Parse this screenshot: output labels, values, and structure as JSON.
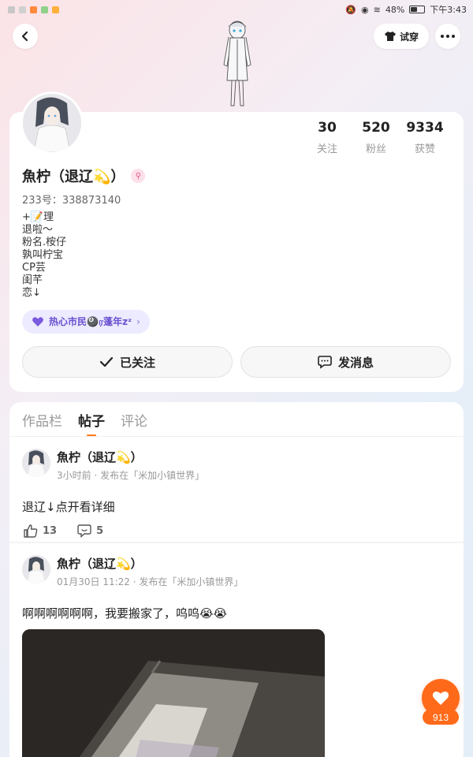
{
  "status_bar": {
    "battery": "48%",
    "battery_level": 0.48,
    "time": "下午3:43"
  },
  "header": {
    "try_on_label": "试穿"
  },
  "profile": {
    "stats": [
      {
        "value": "30",
        "label": "关注"
      },
      {
        "value": "520",
        "label": "粉丝"
      },
      {
        "value": "9334",
        "label": "获赞"
      }
    ],
    "name": "魚柠（退辽💫）",
    "uid": "233号：338873140",
    "bio_lines": [
      "+📝理",
      "退啦～",
      "粉名.桉仔",
      "孰叫柠宝",
      "CP芸",
      "闺芊",
      "恋↓"
    ],
    "title_chip": "热心市民🎱ர蓬年zᶻ",
    "follow_button": "已关注",
    "message_button": "发消息"
  },
  "tabs": [
    {
      "label": "作品栏",
      "active": false
    },
    {
      "label": "帖子",
      "active": true
    },
    {
      "label": "评论",
      "active": false
    }
  ],
  "posts": [
    {
      "author": "魚柠（退辽💫）",
      "meta": "3小时前 · 发布在「米加小镇世界」",
      "text": "退辽↓点开看详细",
      "likes": "13",
      "comments": "5"
    },
    {
      "author": "魚柠（退辽💫）",
      "meta": "01月30日 11:22 · 发布在「米加小镇世界」",
      "text": "啊啊啊啊啊啊，我要搬家了，呜呜😭😭"
    }
  ],
  "floating_like": {
    "count": "913"
  },
  "colors": {
    "accent": "#ff6a1a",
    "chip_text": "#6a4fd0",
    "chip_bg": "#ecebff"
  }
}
